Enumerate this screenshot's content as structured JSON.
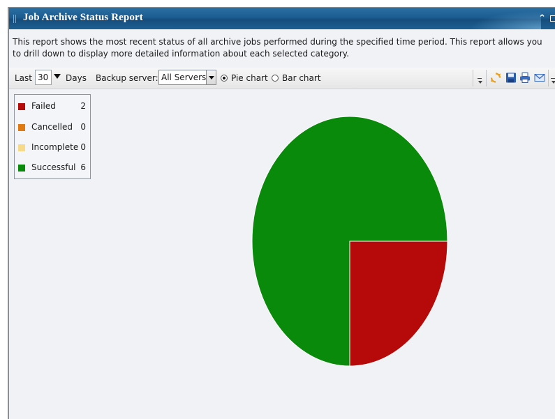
{
  "window": {
    "title": "Job Archive Status Report",
    "collapse_icon": "double-chevron-up-icon",
    "restore_icon": "restore-window-icon"
  },
  "description": "This report shows the most recent status of all archive jobs performed during the specified time period. This report allows you to drill down to display more detailed information about each selected category.",
  "toolbar": {
    "last_label": "Last",
    "days_value": "30",
    "days_label": "Days",
    "backup_server_label": "Backup server:",
    "backup_server_value": "All Servers",
    "pie_chart_label": "Pie chart",
    "bar_chart_label": "Bar chart",
    "pie_selected": true,
    "icons": [
      "refresh-icon",
      "save-icon",
      "print-icon",
      "email-icon"
    ]
  },
  "chart_data": {
    "type": "pie",
    "categories": [
      "Failed",
      "Cancelled",
      "Incomplete",
      "Successful"
    ],
    "values": [
      2,
      0,
      0,
      6
    ],
    "colors": [
      "#b60a0a",
      "#e07a10",
      "#f7d98a",
      "#0a8a0a"
    ],
    "legend_position": "top-left"
  }
}
